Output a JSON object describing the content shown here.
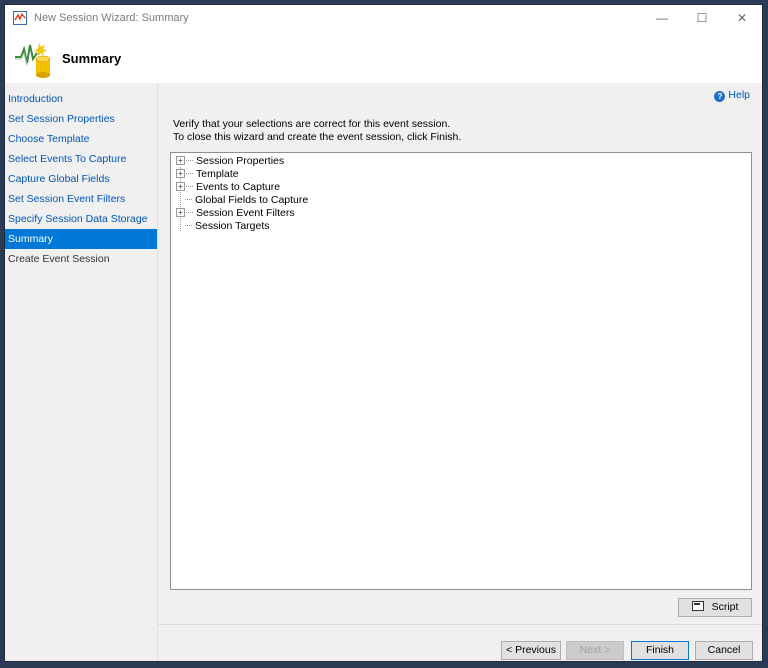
{
  "window": {
    "title": "New Session Wizard: Summary",
    "controls": {
      "minimize": "—",
      "maximize": "☐",
      "close": "✕"
    }
  },
  "header": {
    "title": "Summary"
  },
  "sidebar": {
    "items": [
      {
        "label": "Introduction",
        "state": "link"
      },
      {
        "label": "Set Session Properties",
        "state": "link"
      },
      {
        "label": "Choose Template",
        "state": "link"
      },
      {
        "label": "Select Events To Capture",
        "state": "link"
      },
      {
        "label": "Capture Global Fields",
        "state": "link"
      },
      {
        "label": "Set Session Event Filters",
        "state": "link"
      },
      {
        "label": "Specify Session Data Storage",
        "state": "link"
      },
      {
        "label": "Summary",
        "state": "selected"
      },
      {
        "label": "Create Event Session",
        "state": "future"
      }
    ]
  },
  "content": {
    "help_label": "Help",
    "instruction_line1": "Verify that your selections are correct for this event session.",
    "instruction_line2": "To close this wizard and create the event session, click Finish.",
    "tree": [
      {
        "label": "Session Properties",
        "expandable": true
      },
      {
        "label": "Template",
        "expandable": true
      },
      {
        "label": "Events to Capture",
        "expandable": true
      },
      {
        "label": "Global Fields to Capture",
        "expandable": false
      },
      {
        "label": "Session Event Filters",
        "expandable": true
      },
      {
        "label": "Session Targets",
        "expandable": false
      }
    ],
    "script_label": "Script"
  },
  "footer": {
    "previous_label": "< Previous",
    "next_label": "Next >",
    "finish_label": "Finish",
    "cancel_label": "Cancel"
  },
  "colors": {
    "accent": "#0078d7",
    "link": "#0055b8",
    "background": "#f0f0f0"
  }
}
